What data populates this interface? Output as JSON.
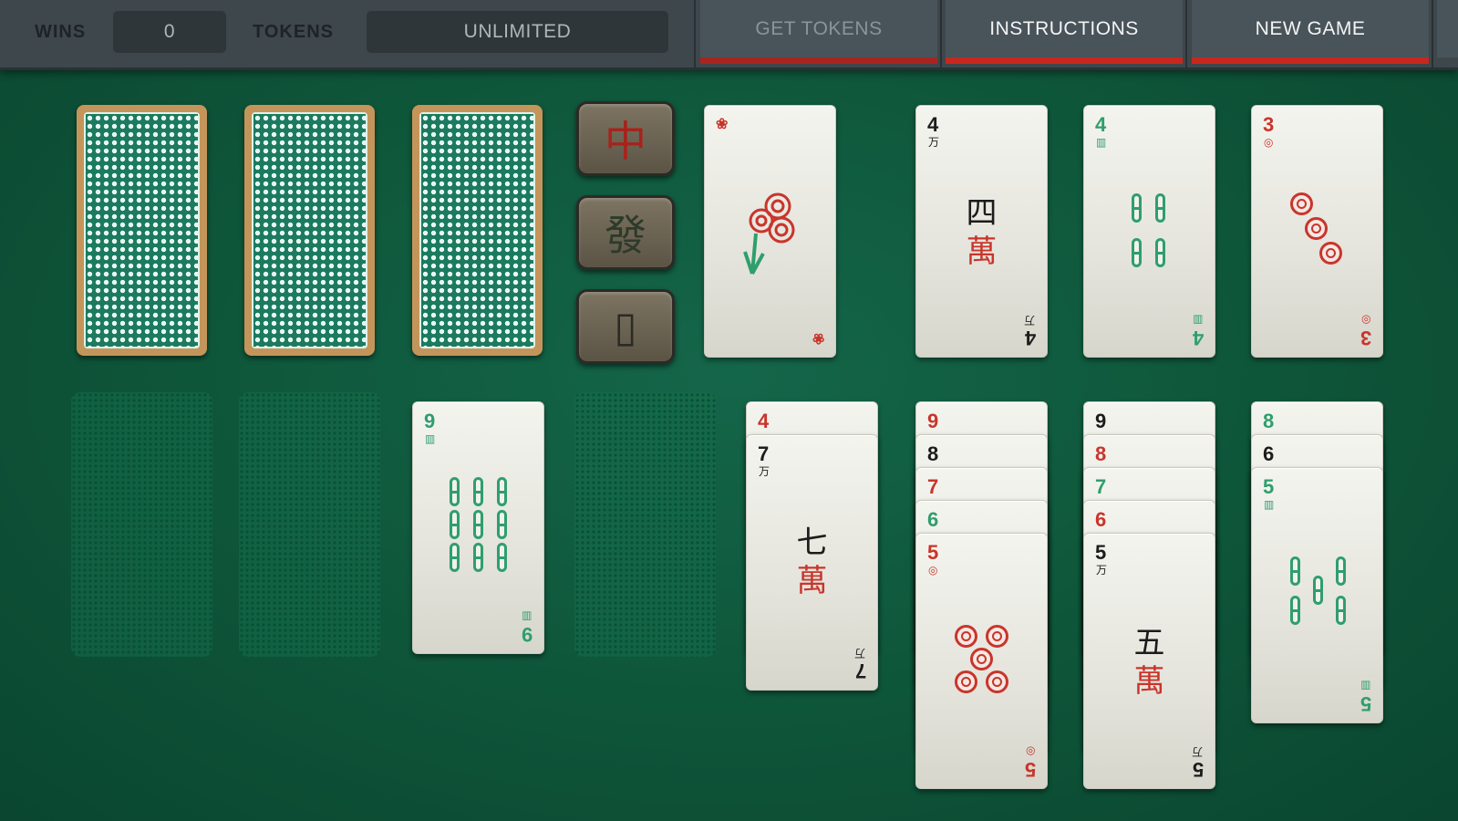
{
  "topbar": {
    "wins_label": "WINS",
    "wins_value": "0",
    "tokens_label": "TOKENS",
    "tokens_value": "UNLIMITED",
    "get_tokens": "GET TOKENS",
    "instructions": "INSTRUCTIONS",
    "new_game": "NEW GAME"
  },
  "dragons": {
    "red": "中",
    "green": "發",
    "white": "▯"
  },
  "foundations": [
    {
      "rank": "",
      "suit": "flower"
    },
    {
      "rank": "4",
      "suit": "characters",
      "han": "四",
      "wan": "萬"
    },
    {
      "rank": "4",
      "suit": "bamboo"
    },
    {
      "rank": "3",
      "suit": "coins"
    }
  ],
  "tableau": {
    "col3": [
      {
        "rank": "9",
        "suit": "bamboo"
      }
    ],
    "col5": [
      {
        "rank": "4",
        "suit": "coins"
      },
      {
        "rank": "7",
        "suit": "characters",
        "han": "七",
        "wan": "萬"
      }
    ],
    "col6": [
      {
        "rank": "9",
        "suit": "coins"
      },
      {
        "rank": "8",
        "suit": "characters"
      },
      {
        "rank": "7",
        "suit": "coins"
      },
      {
        "rank": "6",
        "suit": "bamboo"
      },
      {
        "rank": "5",
        "suit": "coins"
      }
    ],
    "col7": [
      {
        "rank": "9",
        "suit": "characters"
      },
      {
        "rank": "8",
        "suit": "coins"
      },
      {
        "rank": "7",
        "suit": "bamboo"
      },
      {
        "rank": "6",
        "suit": "coins"
      },
      {
        "rank": "5",
        "suit": "characters",
        "han": "五",
        "wan": "萬"
      }
    ],
    "col8": [
      {
        "rank": "8",
        "suit": "bamboo"
      },
      {
        "rank": "6",
        "suit": "characters"
      },
      {
        "rank": "5",
        "suit": "bamboo"
      }
    ]
  },
  "colors": {
    "felt": "#0e5539",
    "topbar": "#3e474b",
    "accent_red": "#c8271d",
    "coin_red": "#c9352b",
    "bamboo_green": "#2f9e6d",
    "card_back_border": "#c4955a"
  }
}
